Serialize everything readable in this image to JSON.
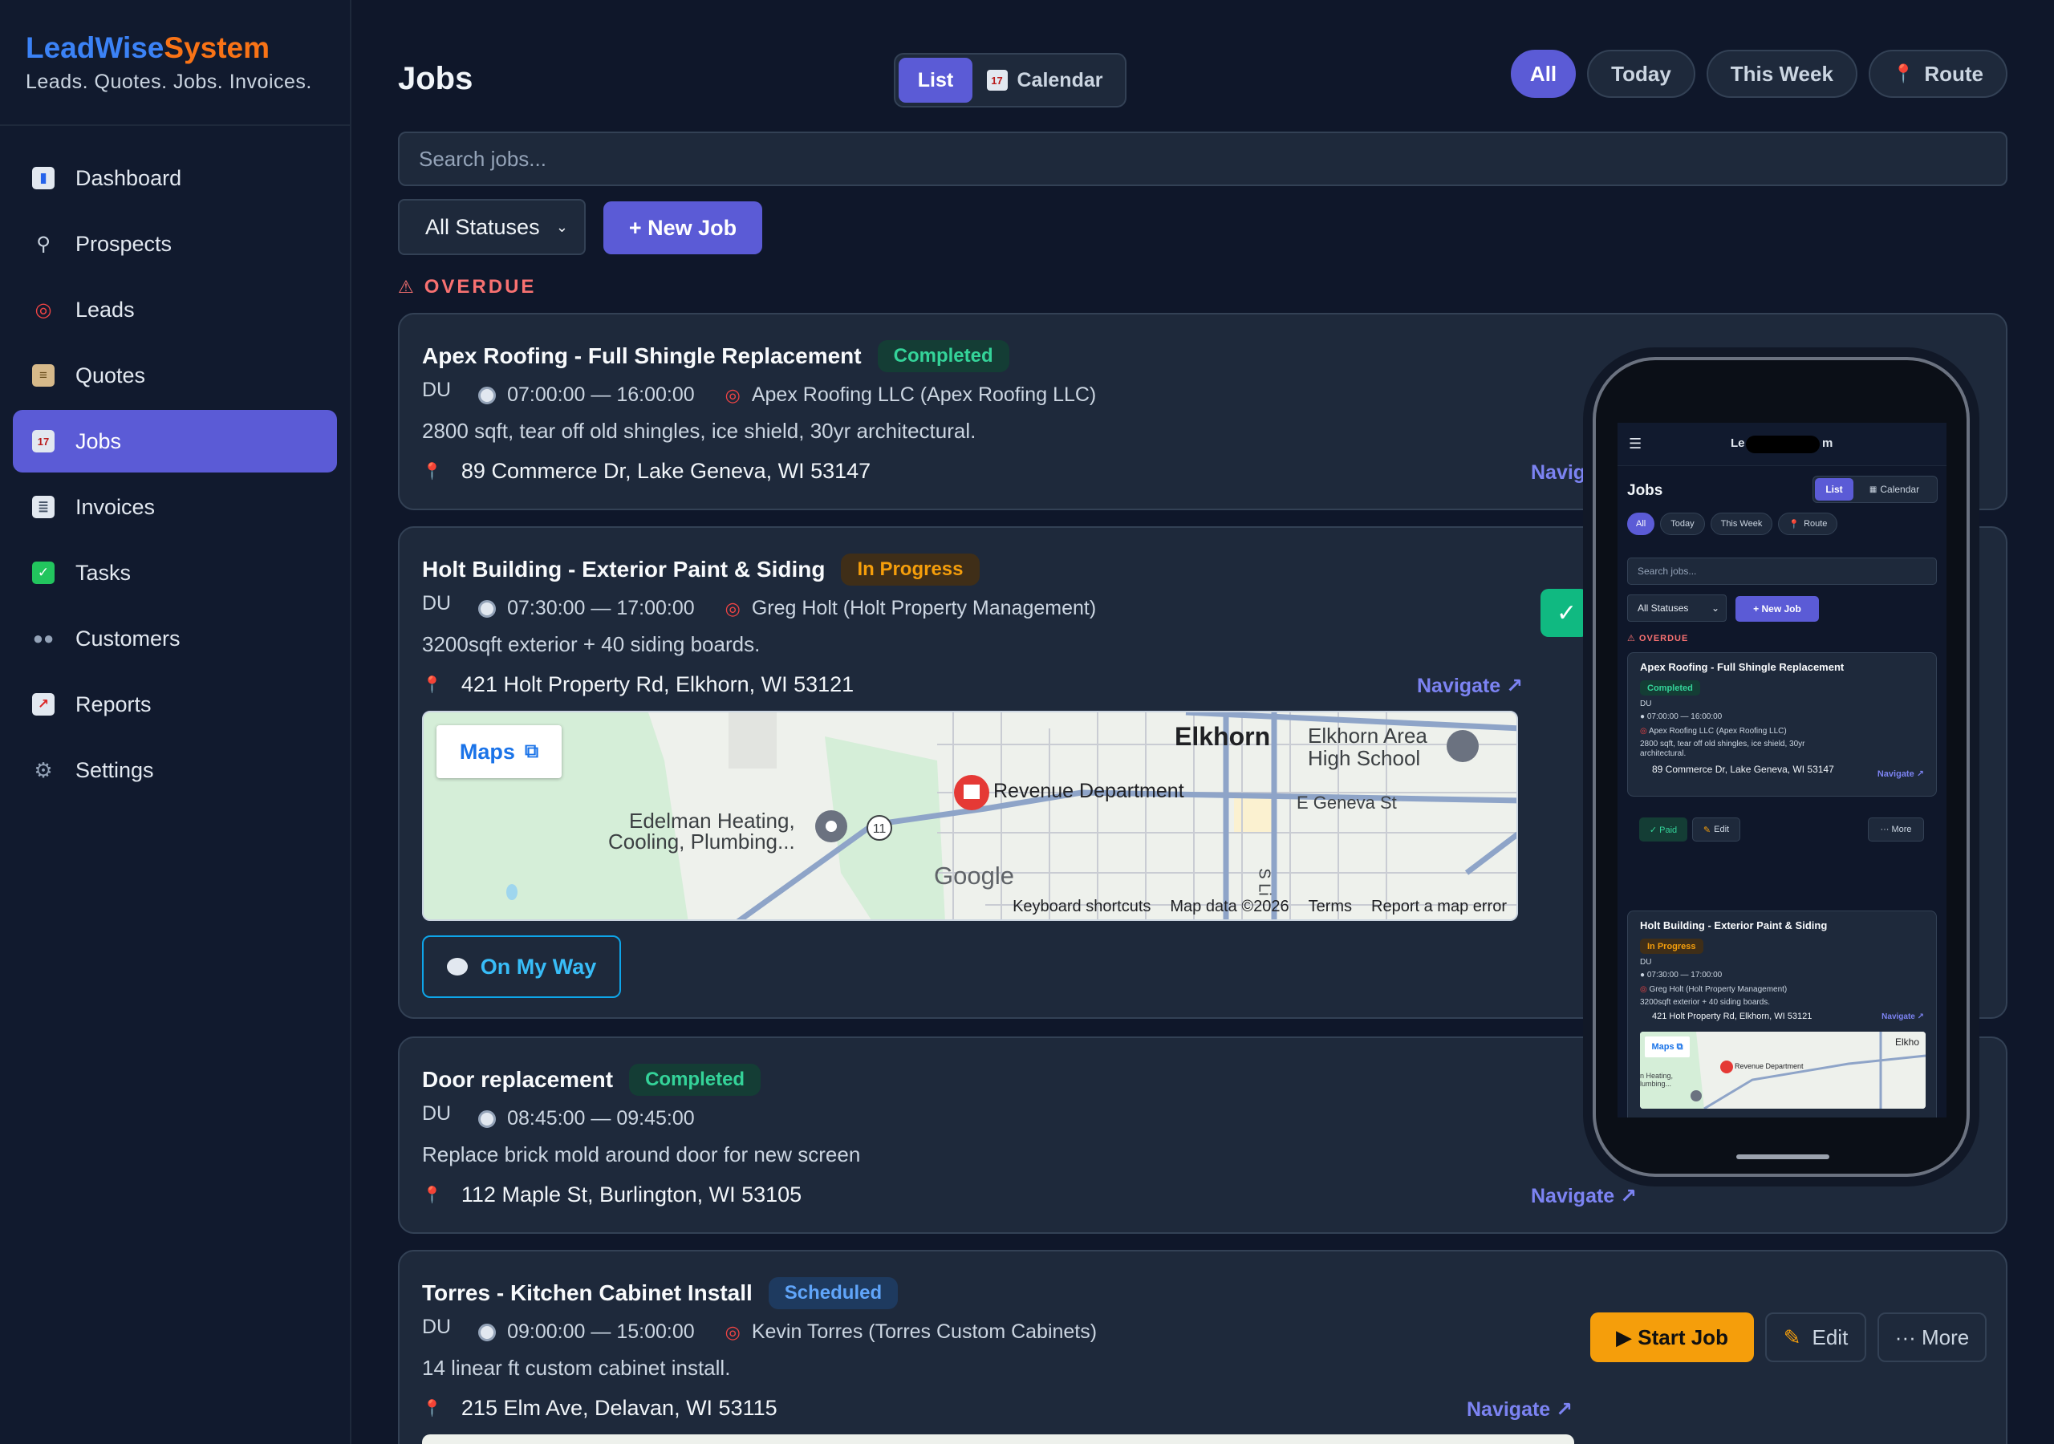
{
  "brand": {
    "part1": "LeadWise",
    "part2": "System",
    "tagline": "Leads. Quotes. Jobs. Invoices."
  },
  "sidebar": {
    "items": [
      {
        "label": "Dashboard",
        "icon": "bar-chart-icon"
      },
      {
        "label": "Prospects",
        "icon": "magnifier-icon"
      },
      {
        "label": "Leads",
        "icon": "target-icon"
      },
      {
        "label": "Quotes",
        "icon": "clipboard-icon"
      },
      {
        "label": "Jobs",
        "icon": "calendar-icon",
        "active": true
      },
      {
        "label": "Invoices",
        "icon": "receipt-icon"
      },
      {
        "label": "Tasks",
        "icon": "check-box-icon"
      },
      {
        "label": "Customers",
        "icon": "people-icon"
      },
      {
        "label": "Reports",
        "icon": "line-chart-icon"
      },
      {
        "label": "Settings",
        "icon": "gear-icon"
      }
    ]
  },
  "header": {
    "title": "Jobs",
    "view_list": "List",
    "view_calendar": "Calendar",
    "filters": {
      "all": "All",
      "today": "Today",
      "week": "This Week",
      "route": "Route"
    }
  },
  "search": {
    "placeholder": "Search jobs..."
  },
  "toolbar": {
    "status_select": "All Statuses",
    "new_job": "+ New Job"
  },
  "section": {
    "overdue": "OVERDUE"
  },
  "jobs": [
    {
      "title": "Apex Roofing - Full Shingle Replacement",
      "status": "Completed",
      "du": "DU",
      "time": "07:00:00 — 16:00:00",
      "customer": "Apex Roofing LLC (Apex Roofing LLC)",
      "description": "2800 sqft, tear off old shingles, ice shield, 30yr architectural.",
      "address": "89 Commerce Dr, Lake Geneva, WI 53147",
      "navigate": "Navigate ↗"
    },
    {
      "title": "Holt Building - Exterior Paint & Siding",
      "status": "In Progress",
      "du": "DU",
      "time": "07:30:00 — 17:00:00",
      "customer": "Greg Holt (Holt Property Management)",
      "description": "3200sqft exterior + 40 siding boards.",
      "address": "421 Holt Property Rd, Elkhorn, WI 53121",
      "navigate": "Navigate ↗",
      "on_my_way": "On My Way",
      "map": {
        "maps_button": "Maps",
        "labels": [
          "Elkhorn",
          "Elkhorn Area",
          "High School",
          "Revenue Department",
          "E Geneva St",
          "Edelman Heating,",
          "Cooling, Plumbing...",
          "11",
          "S Li"
        ],
        "google": "Google",
        "footer": [
          "Keyboard shortcuts",
          "Map data ©2026",
          "Terms",
          "Report a map error"
        ]
      }
    },
    {
      "title": "Door replacement",
      "status": "Completed",
      "du": "DU",
      "time": "08:45:00 — 09:45:00",
      "description": "Replace brick mold around door for new screen",
      "address": "112 Maple St, Burlington, WI 53105",
      "navigate": "Navigate ↗"
    },
    {
      "title": "Torres - Kitchen Cabinet Install",
      "status": "Scheduled",
      "du": "DU",
      "time": "09:00:00 — 15:00:00",
      "customer": "Kevin Torres (Torres Custom Cabinets)",
      "description": "14 linear ft custom cabinet install.",
      "address": "215 Elm Ave, Delavan, WI 53115",
      "navigate": "Navigate ↗",
      "actions": {
        "start": "▶ Start Job",
        "edit": "Edit",
        "more": "··· More"
      }
    }
  ],
  "phone": {
    "brand_left": "Le",
    "brand_right": "m",
    "title": "Jobs",
    "list": "List",
    "calendar": "Calendar",
    "pills": [
      "All",
      "Today",
      "This Week",
      "Route"
    ],
    "search": "Search jobs...",
    "status": "All Statuses",
    "new_job": "+ New Job",
    "overdue": "OVERDUE",
    "card1": {
      "title": "Apex Roofing - Full Shingle Replacement",
      "status": "Completed",
      "du": "DU",
      "time": "07:00:00 — 16:00:00",
      "customer": "Apex Roofing LLC (Apex Roofing LLC)",
      "desc1": "2800 sqft, tear off old shingles, ice shield, 30yr",
      "desc2": "architectural.",
      "addr": "89 Commerce Dr, Lake Geneva, WI 53147",
      "navigate": "Navigate ↗",
      "paid": "✓ Paid",
      "edit": "Edit",
      "more": "··· More"
    },
    "card2": {
      "title": "Holt Building - Exterior Paint & Siding",
      "status": "In Progress",
      "du": "DU",
      "time": "07:30:00 — 17:00:00",
      "customer": "Greg Holt (Holt Property Management)",
      "desc": "3200sqft exterior + 40 siding boards.",
      "addr": "421 Holt Property Rd, Elkhorn, WI 53121",
      "navigate": "Navigate ↗",
      "maps": "Maps",
      "map_labels": [
        "Elkho",
        "Revenue Department",
        "n Heating,",
        "lumbing..."
      ]
    }
  },
  "colors": {
    "accent": "#5b5bd6",
    "completed": "#34d399",
    "in_progress": "#f59e0b",
    "scheduled": "#60a5fa",
    "overdue": "#f87171"
  }
}
